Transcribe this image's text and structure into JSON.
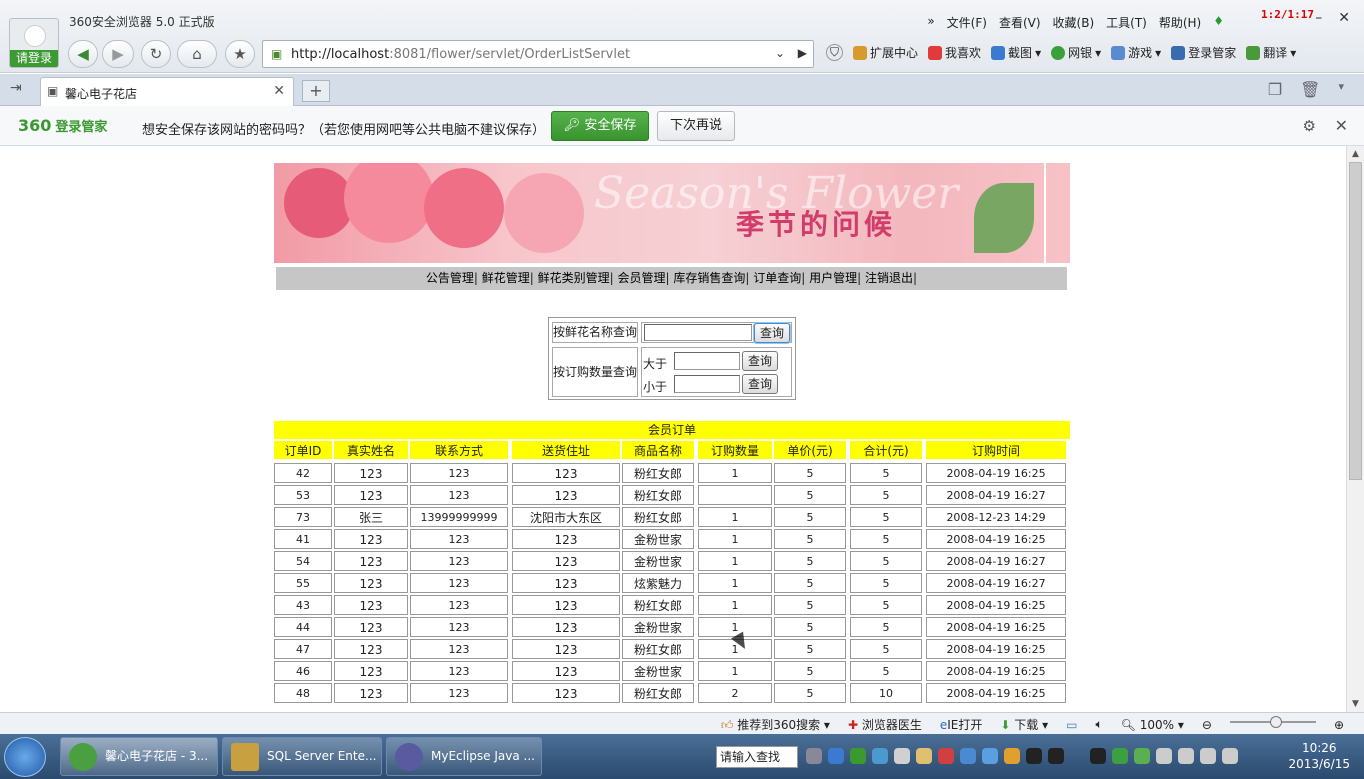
{
  "browser": {
    "app_title": "360安全浏览器 5.0 正式版",
    "login_label": "请登录",
    "menu": [
      "文件(F)",
      "查看(V)",
      "收藏(B)",
      "工具(T)",
      "帮助(H)"
    ],
    "corner_time": "1:2/1:17",
    "url_host": "http://localhost",
    "url_rest": ":8081/flower/servlet/OrderListServlet",
    "toolbar": [
      "扩展中心",
      "我喜欢",
      "截图",
      "网银",
      "游戏",
      "登录管家",
      "翻译"
    ]
  },
  "tab": {
    "title": "馨心电子花店"
  },
  "password_bar": {
    "logo": "360",
    "logo_text": "登录管家",
    "message": "想安全保存该网站的密码吗？（若您使用网吧等公共电脑不建议保存）",
    "save_label": "安全保存",
    "later_label": "下次再说"
  },
  "banner": {
    "en_text": "Season's Flower",
    "cn_text": "季节的问候"
  },
  "nav_links": [
    "公告管理",
    "鲜花管理",
    "鲜花类别管理",
    "会员管理",
    "库存销售查询",
    "订单查询",
    "用户管理",
    "注销退出"
  ],
  "search": {
    "by_name_label": "按鲜花名称查询",
    "by_qty_label": "按订购数量查询",
    "greater_label": "大于",
    "less_label": "小于",
    "query_button": "查询"
  },
  "orders": {
    "title": "会员订单",
    "headers": [
      "订单ID",
      "真实姓名",
      "联系方式",
      "送货住址",
      "商品名称",
      "订购数量",
      "单价(元)",
      "合计(元)",
      "订购时间"
    ],
    "rows": [
      [
        "42",
        "123",
        "123",
        "123",
        "粉红女郎",
        "1",
        "5",
        "5",
        "2008-04-19 16:25"
      ],
      [
        "53",
        "123",
        "123",
        "123",
        "粉红女郎",
        "",
        "5",
        "5",
        "2008-04-19 16:27"
      ],
      [
        "73",
        "张三",
        "13999999999",
        "沈阳市大东区",
        "粉红女郎",
        "1",
        "5",
        "5",
        "2008-12-23 14:29"
      ],
      [
        "41",
        "123",
        "123",
        "123",
        "金粉世家",
        "1",
        "5",
        "5",
        "2008-04-19 16:25"
      ],
      [
        "54",
        "123",
        "123",
        "123",
        "金粉世家",
        "1",
        "5",
        "5",
        "2008-04-19 16:27"
      ],
      [
        "55",
        "123",
        "123",
        "123",
        "炫紫魅力",
        "1",
        "5",
        "5",
        "2008-04-19 16:27"
      ],
      [
        "43",
        "123",
        "123",
        "123",
        "粉红女郎",
        "1",
        "5",
        "5",
        "2008-04-19 16:25"
      ],
      [
        "44",
        "123",
        "123",
        "123",
        "金粉世家",
        "1",
        "5",
        "5",
        "2008-04-19 16:25"
      ],
      [
        "47",
        "123",
        "123",
        "123",
        "粉红女郎",
        "1",
        "5",
        "5",
        "2008-04-19 16:25"
      ],
      [
        "46",
        "123",
        "123",
        "123",
        "金粉世家",
        "1",
        "5",
        "5",
        "2008-04-19 16:25"
      ],
      [
        "48",
        "123",
        "123",
        "123",
        "粉红女郎",
        "2",
        "5",
        "10",
        "2008-04-19 16:25"
      ]
    ]
  },
  "statusbar": {
    "items": [
      "推荐到360搜索",
      "浏览器医生",
      "IE打开",
      "下载"
    ],
    "zoom": "100%"
  },
  "taskbar": {
    "tasks": [
      "馨心电子花店 - 3...",
      "SQL Server Ente...",
      "MyEclipse Java ..."
    ],
    "search_placeholder": "请输入查找",
    "time": "10:26",
    "date": "2013/6/15"
  }
}
